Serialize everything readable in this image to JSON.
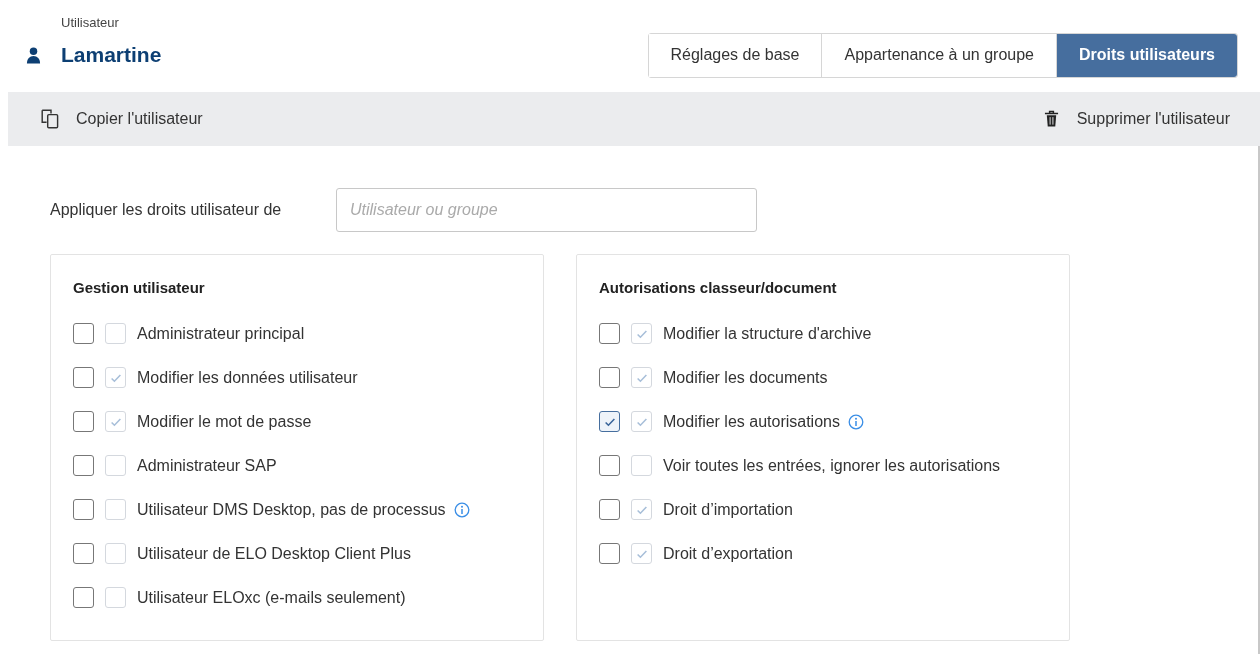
{
  "header": {
    "caption": "Utilisateur",
    "name": "Lamartine"
  },
  "tabs": [
    {
      "label": "Réglages de base",
      "selected": false
    },
    {
      "label": "Appartenance à un groupe",
      "selected": false
    },
    {
      "label": "Droits utilisateurs",
      "selected": true
    }
  ],
  "toolbar": {
    "copy": "Copier l'utilisateur",
    "delete": "Supprimer l'utilisateur"
  },
  "apply_rights": {
    "label": "Appliquer les droits utilisateur de",
    "placeholder": "Utilisateur ou groupe"
  },
  "panels": [
    {
      "title": "Gestion utilisateur",
      "items": [
        {
          "label": "Administrateur principal",
          "checked": false,
          "inherited": false,
          "info": false
        },
        {
          "label": "Modifier les données utilisateur",
          "checked": false,
          "inherited": true,
          "info": false
        },
        {
          "label": "Modifier le mot de passe",
          "checked": false,
          "inherited": true,
          "info": false
        },
        {
          "label": "Administrateur SAP",
          "checked": false,
          "inherited": false,
          "info": false
        },
        {
          "label": "Utilisateur DMS Desktop, pas de processus",
          "checked": false,
          "inherited": false,
          "info": true
        },
        {
          "label": "Utilisateur de ELO Desktop Client Plus",
          "checked": false,
          "inherited": false,
          "info": false
        },
        {
          "label": "Utilisateur ELOxc (e-mails seulement)",
          "checked": false,
          "inherited": false,
          "info": false
        }
      ]
    },
    {
      "title": "Autorisations classeur/document",
      "items": [
        {
          "label": "Modifier la structure d'archive",
          "checked": false,
          "inherited": true,
          "info": false
        },
        {
          "label": "Modifier les documents",
          "checked": false,
          "inherited": true,
          "info": false
        },
        {
          "label": "Modifier les autorisations",
          "checked": true,
          "inherited": true,
          "info": true
        },
        {
          "label": "Voir toutes les entrées, ignorer les autorisations",
          "checked": false,
          "inherited": false,
          "info": false
        },
        {
          "label": "Droit d’importation",
          "checked": false,
          "inherited": true,
          "info": false
        },
        {
          "label": "Droit d’exportation",
          "checked": false,
          "inherited": true,
          "info": false
        }
      ]
    }
  ]
}
